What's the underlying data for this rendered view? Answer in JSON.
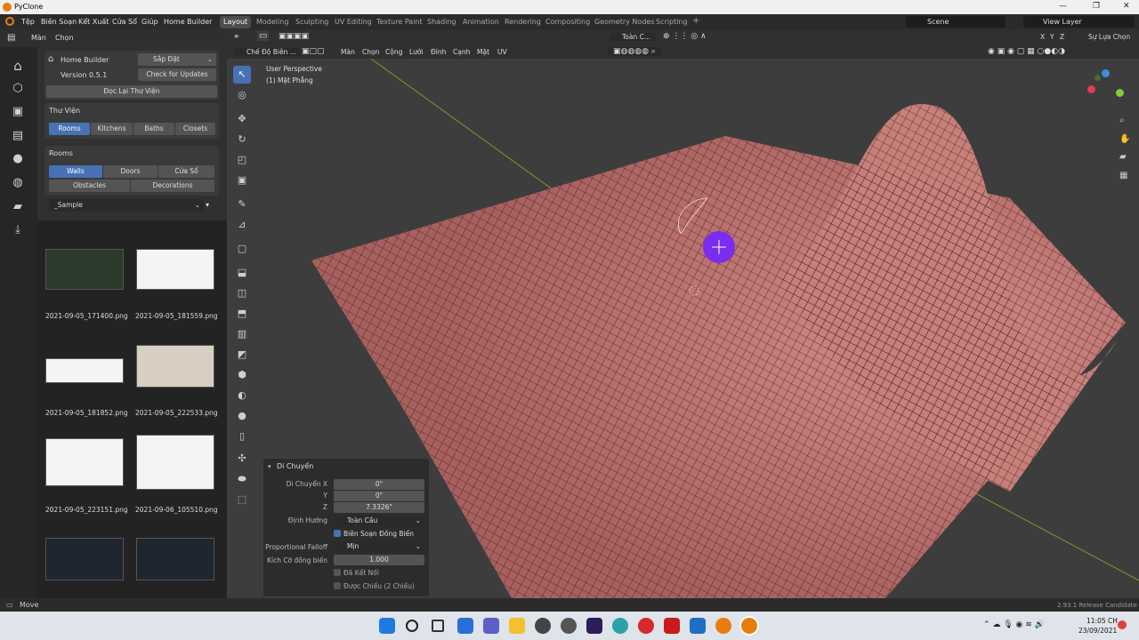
{
  "window": {
    "title": "PyClone"
  },
  "menu": [
    "Tệp",
    "Biên Soạn",
    "Kết Xuất",
    "Cửa Sổ",
    "Giúp",
    "Home Builder"
  ],
  "workspaces": [
    "Layout",
    "Modeling",
    "Sculpting",
    "UV Editing",
    "Texture Paint",
    "Shading",
    "Animation",
    "Rendering",
    "Compositing",
    "Geometry Nodes",
    "Scripting",
    "+"
  ],
  "scene": "Scene",
  "view_layer": "View Layer",
  "subbar": {
    "view": "Màn",
    "select": "Chọn"
  },
  "home_builder": {
    "title": "Home Builder",
    "setup": "Sắp Đặt",
    "version": "Version 0.5.1",
    "check": "Check for Updates",
    "reload": "Đọc Lại Thư Viện",
    "library": "Thư Viện",
    "lib_tabs": [
      "Rooms",
      "Kitchens",
      "Baths",
      "Closets"
    ],
    "rooms": "Rooms",
    "room_tabs": [
      "Walls",
      "Doors",
      "Cửa Sổ"
    ],
    "room_tabs2": [
      "Obstacles",
      "Decorations"
    ],
    "sample": "_Sample"
  },
  "thumbnails": [
    "2021-09-05_171400.png",
    "2021-09-05_181559.png",
    "2021-09-05_181852.png",
    "2021-09-05_222533.png",
    "2021-09-05_223151.png",
    "2021-09-06_105510.png"
  ],
  "viewport": {
    "mode": "Chế Độ Biên ...",
    "menus": [
      "Màn",
      "Chọn",
      "Cộng",
      "Lưới",
      "Đỉnh",
      "Cạnh",
      "Mặt",
      "UV"
    ],
    "perspective": "User Perspective",
    "object": "(1) Mặt Phẳng",
    "transform": "Toàn C...",
    "xyz": [
      "X",
      "Y",
      "Z"
    ],
    "options": "Sự Lựa Chọn"
  },
  "operator": {
    "title": "Di Chuyển",
    "labels": [
      "Di Chuyển X",
      "Y",
      "Z",
      "Định Hướng",
      "Proportional Falloff",
      "Kích Cỡ đồng biến"
    ],
    "x": "0\"",
    "y": "0\"",
    "z": "7.3326\"",
    "orientation": "Toàn Cầu",
    "prop_edit": "Biên Soạn Đồng Biến",
    "falloff": "Mịn",
    "size": "1.000",
    "connected": "Đã Kết Nối",
    "projected": "Được Chiếu (2 Chiều)"
  },
  "status": {
    "left": "Move",
    "right": "2.93.1 Release Candidate"
  },
  "clock": {
    "time": "11:05 CH",
    "date": "23/09/2021"
  },
  "colors": {
    "accent": "#4772b3",
    "mesh": "#b86b6b",
    "brush": "#7b2cf0"
  }
}
